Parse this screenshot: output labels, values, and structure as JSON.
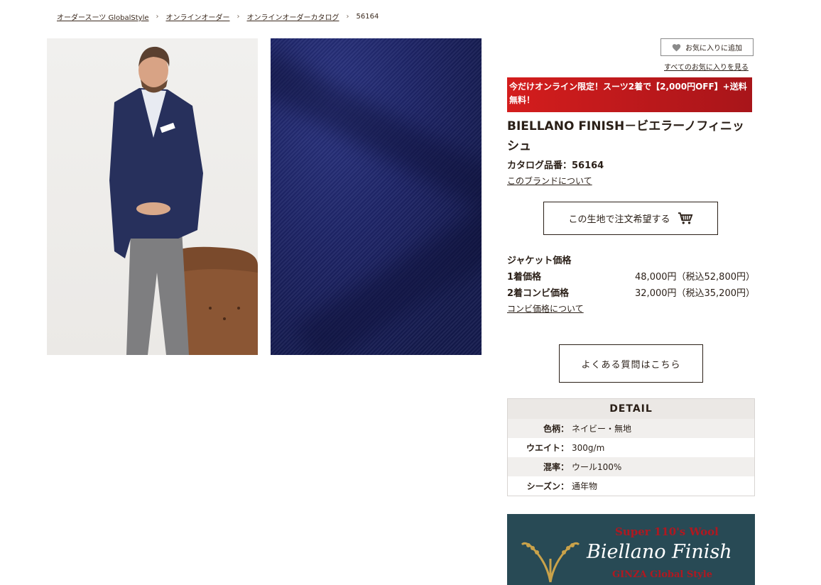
{
  "breadcrumb": {
    "items": [
      "オーダースーツ GlobalStyle",
      "オンラインオーダー",
      "オンラインオーダーカタログ",
      "56164"
    ],
    "separator": "›"
  },
  "favorites": {
    "add_label": "お気に入りに追加",
    "view_all_label": "すべてのお気に入りを見る"
  },
  "promo": {
    "text": "今だけオンライン限定！スーツ2着で【2,000円OFF】+送料無料！"
  },
  "product": {
    "title": "BIELLANO FINISH－ビエラーノフィニッシュ",
    "catalog_number": "カタログ品番：56164",
    "brand_link": "このブランドについて",
    "order_button": "この生地で注文希望する"
  },
  "pricing": {
    "heading": "ジャケット価格",
    "rows": [
      {
        "label": "1着価格",
        "value": "48,000円（税込52,800円）"
      },
      {
        "label": "2着コンビ価格",
        "value": "32,000円（税込35,200円）"
      }
    ],
    "combi_link": "コンビ価格について"
  },
  "faq_button": "よくある質問はこちら",
  "detail": {
    "heading": "DETAIL",
    "rows": [
      {
        "key": "色柄：",
        "value": "ネイビー・無地"
      },
      {
        "key": "ウエイト：",
        "value": "300g/m"
      },
      {
        "key": "混率：",
        "value": "ウール100%"
      },
      {
        "key": "シーズン：",
        "value": "通年物"
      }
    ]
  },
  "banner": {
    "top_text": "Super 110's Wool",
    "main_text": "Biellano Finish",
    "sub_text": "GINZA Global Style"
  },
  "colors": {
    "promo_red": "#d41d1d",
    "banner_teal": "#284a55",
    "fabric_navy": "#1d2466"
  }
}
